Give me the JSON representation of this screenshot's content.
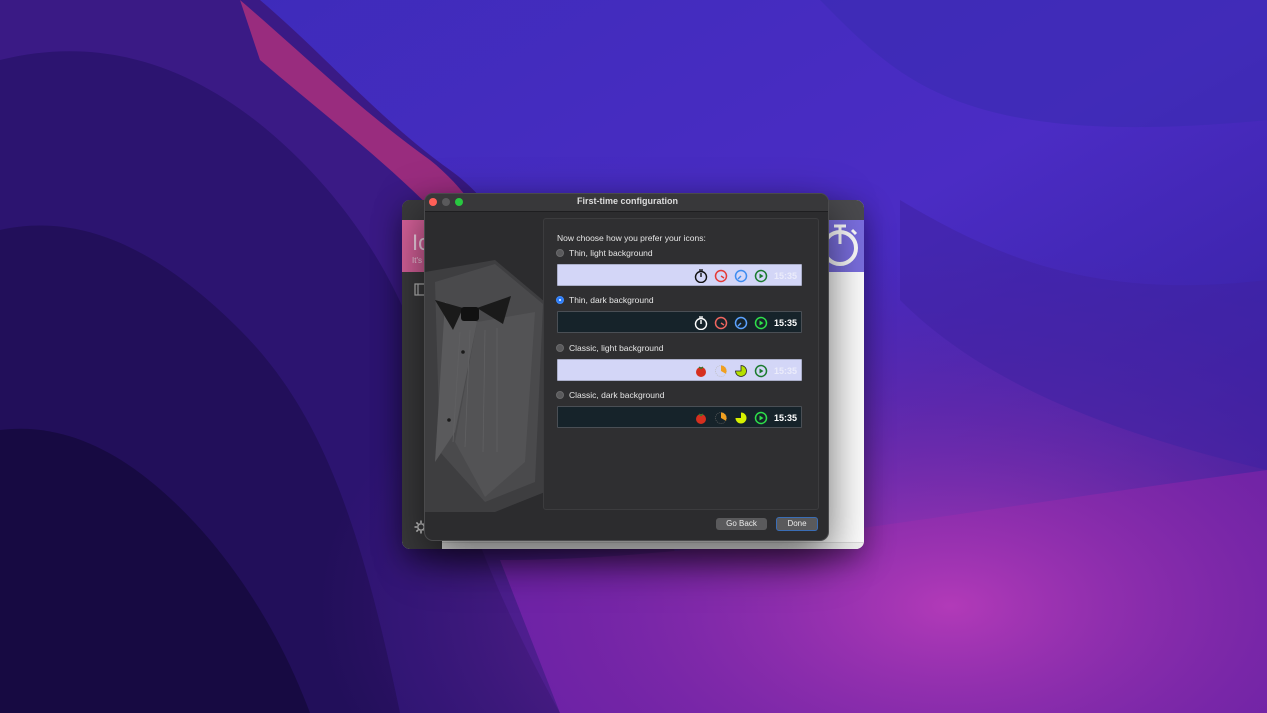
{
  "background_window": {
    "title_fragment": "Io",
    "subtitle_fragment": "It's"
  },
  "dialog": {
    "title": "First-time configuration",
    "prompt": "Now choose how you prefer your icons:",
    "options": [
      {
        "label": "Thin, light background",
        "selected": false,
        "style": "light"
      },
      {
        "label": "Thin, dark background",
        "selected": true,
        "style": "dark"
      },
      {
        "label": "Classic, light background",
        "selected": false,
        "style": "light"
      },
      {
        "label": "Classic, dark background",
        "selected": false,
        "style": "dark"
      }
    ],
    "preview_clock": "15:35",
    "buttons": {
      "back": "Go Back",
      "done": "Done"
    }
  },
  "colors": {
    "accent": "#2d7cf6",
    "traffic_close": "#ff5f57",
    "traffic_max": "#28c840"
  },
  "icons": [
    "stopwatch-icon",
    "timer-red-icon",
    "timer-blue-icon",
    "play-green-icon",
    "tomato-icon",
    "pie-orange-icon",
    "pie-yellow-icon"
  ]
}
